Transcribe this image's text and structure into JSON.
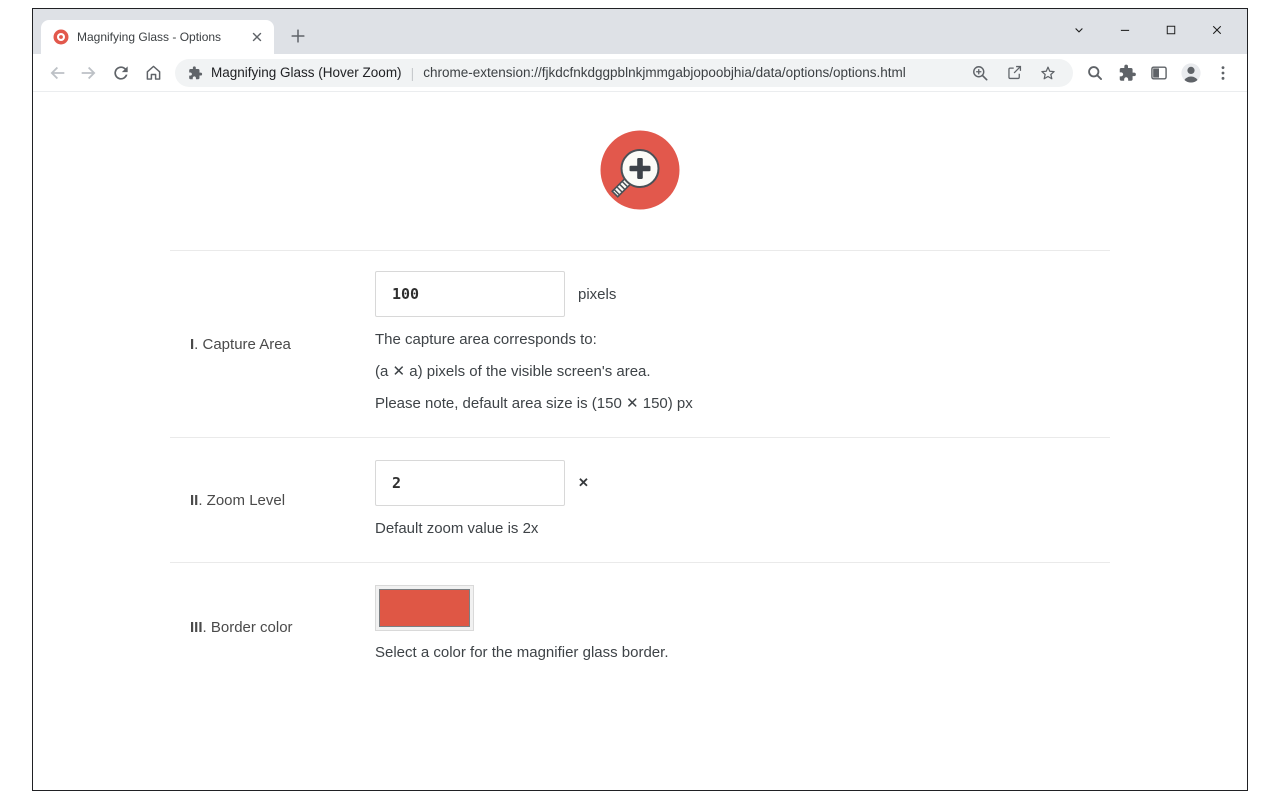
{
  "window": {
    "tab": {
      "title": "Magnifying Glass - Options"
    },
    "address_bar": {
      "page_title": "Magnifying Glass (Hover Zoom)",
      "separator": "|",
      "url": "chrome-extension://fjkdcfnkdggpblnkjmmgabjopoobjhia/data/options/options.html"
    }
  },
  "content": {
    "sections": [
      {
        "numeral": "I",
        "label_rest": ". Capture Area",
        "input_value": "100",
        "input_suffix": "pixels",
        "lines": [
          "The capture area corresponds to:",
          "(a ✕ a) pixels of the visible screen's area.",
          "Please note, default area size is (150 ✕ 150) px"
        ]
      },
      {
        "numeral": "II",
        "label_rest": ". Zoom Level",
        "input_value": "2",
        "input_suffix": "✕",
        "lines": [
          "Default zoom value is 2x"
        ]
      },
      {
        "numeral": "III",
        "label_rest": ". Border color",
        "swatch_color": "#df5745",
        "lines": [
          "Select a color for the magnifier glass border."
        ]
      }
    ]
  },
  "colors": {
    "accent_red": "#e2584c",
    "swatch_red": "#df5745",
    "tab_strip_bg": "#dee1e6",
    "omnibox_bg": "#f1f3f4",
    "icon_gray": "#5f6368"
  }
}
